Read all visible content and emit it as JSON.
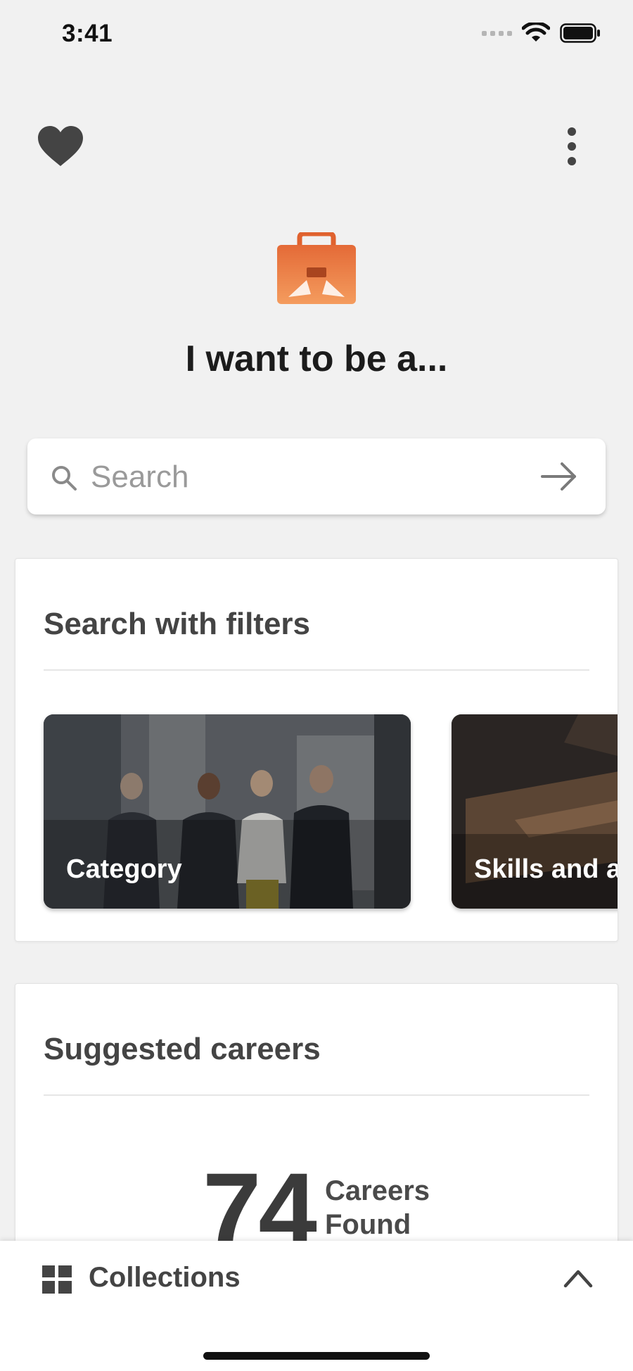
{
  "status_bar": {
    "time": "3:41"
  },
  "header": {
    "heart_icon": "heart-icon",
    "more_icon": "more-vertical-icon"
  },
  "hero": {
    "icon": "briefcase-icon",
    "title": "I want to be a..."
  },
  "search": {
    "placeholder": "Search"
  },
  "filters": {
    "title": "Search with filters",
    "tiles": [
      {
        "label": "Category"
      },
      {
        "label": "Skills and a"
      }
    ]
  },
  "suggested": {
    "title": "Suggested careers",
    "count": "74",
    "count_label_line1": "Careers",
    "count_label_line2": "Found"
  },
  "bottom_sheet": {
    "label": "Collections"
  },
  "colors": {
    "accent": "#e8743b",
    "background": "#f1f1f1",
    "text_dark": "#444444"
  }
}
